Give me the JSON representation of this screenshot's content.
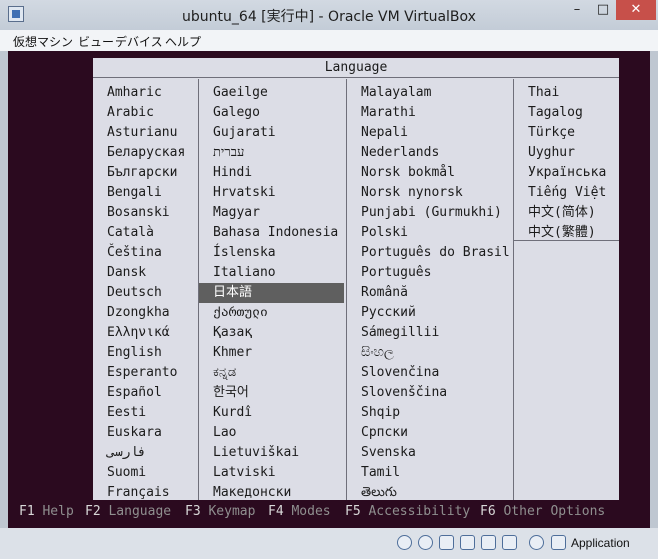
{
  "window": {
    "title": "ubuntu_64 [実行中] - Oracle VM VirtualBox",
    "min_glyph": "–",
    "max_glyph": "□",
    "close_glyph": "✕"
  },
  "menu": [
    "仮想マシン",
    "ビュー",
    "デバイス",
    "ヘルプ"
  ],
  "dialog": {
    "title": "Language",
    "columns": [
      [
        "Amharic",
        "Arabic",
        "Asturianu",
        "Беларуская",
        "Български",
        "Bengali",
        "Bosanski",
        "Català",
        "Čeština",
        "Dansk",
        "Deutsch",
        "Dzongkha",
        "Ελληνικά",
        "English",
        "Esperanto",
        "Español",
        "Eesti",
        "Euskara",
        "فارسی",
        "Suomi",
        "Français"
      ],
      [
        "Gaeilge",
        "Galego",
        "Gujarati",
        "עברית",
        "Hindi",
        "Hrvatski",
        "Magyar",
        "Bahasa Indonesia",
        "Íslenska",
        "Italiano",
        "日本語",
        "ქართული",
        "Қазақ",
        "Khmer",
        "ಕನ್ನಡ",
        "한국어",
        "Kurdî",
        "Lao",
        "Lietuviškai",
        "Latviski",
        "Македонски"
      ],
      [
        "Malayalam",
        "Marathi",
        "Nepali",
        "Nederlands",
        "Norsk bokmål",
        "Norsk nynorsk",
        "Punjabi (Gurmukhi)",
        "Polski",
        "Português do Brasil",
        "Português",
        "Română",
        "Русский",
        "Sámegillii",
        "සිංහල",
        "Slovenčina",
        "Slovenščina",
        "Shqip",
        "Српски",
        "Svenska",
        "Tamil",
        "తెలుగు"
      ],
      [
        "Thai",
        "Tagalog",
        "Türkçe",
        "Uyghur",
        "Українська",
        "Tiếng Việt",
        "中文(简体)",
        "中文(繁體)"
      ]
    ],
    "selected": "日本語"
  },
  "function_keys": [
    {
      "key": "F1",
      "label": "Help"
    },
    {
      "key": "F2",
      "label": "Language"
    },
    {
      "key": "F3",
      "label": "Keymap"
    },
    {
      "key": "F4",
      "label": "Modes"
    },
    {
      "key": "F5",
      "label": "Accessibility"
    },
    {
      "key": "F6",
      "label": "Other Options"
    }
  ],
  "status": {
    "icons": [
      "hard-disk-icon",
      "optical-drive-icon",
      "usb-icon",
      "shared-folder-icon",
      "display-icon",
      "network-icon",
      "video-capture-icon",
      "mouse-integration-icon",
      "host-key-arrow-icon"
    ],
    "host_key": "Application",
    "colors": {
      "selection": "#5f5f5f",
      "dialog": "#dcdde6",
      "console": "#2b0a1f",
      "close": "#c7504a"
    }
  }
}
